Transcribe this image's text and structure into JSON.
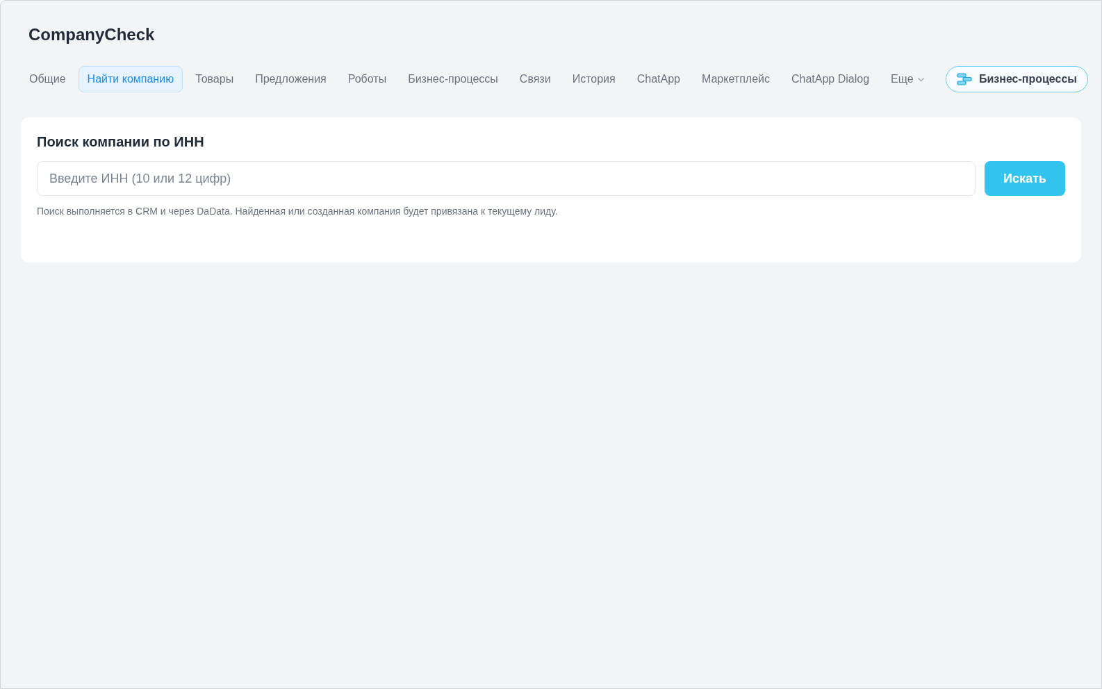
{
  "app": {
    "title": "CompanyCheck"
  },
  "tabs": [
    {
      "label": "Общие",
      "selected": false,
      "kind": "tab"
    },
    {
      "label": "Найти компанию",
      "selected": true,
      "kind": "tab"
    },
    {
      "label": "Товары",
      "selected": false,
      "kind": "tab"
    },
    {
      "label": "Предложения",
      "selected": false,
      "kind": "tab"
    },
    {
      "label": "Роботы",
      "selected": false,
      "kind": "tab"
    },
    {
      "label": "Бизнес-процессы",
      "selected": false,
      "kind": "tab"
    },
    {
      "label": "Связи",
      "selected": false,
      "kind": "tab"
    },
    {
      "label": "История",
      "selected": false,
      "kind": "tab"
    },
    {
      "label": "ChatApp",
      "selected": false,
      "kind": "tab"
    },
    {
      "label": "Маркетплейс",
      "selected": false,
      "kind": "tab"
    },
    {
      "label": "ChatApp Dialog",
      "selected": false,
      "kind": "tab"
    },
    {
      "label": "Еще",
      "selected": false,
      "kind": "dropdown"
    }
  ],
  "header_button": {
    "label": "Бизнес-процессы"
  },
  "search_card": {
    "title": "Поиск компании по ИНН",
    "input": {
      "placeholder": "Введите ИНН (10 или 12 цифр)"
    },
    "button": "Искать",
    "hint": "Поиск выполняется в CRM и через DaData. Найденная или созданная компания будет привязана к текущему лиду."
  }
}
